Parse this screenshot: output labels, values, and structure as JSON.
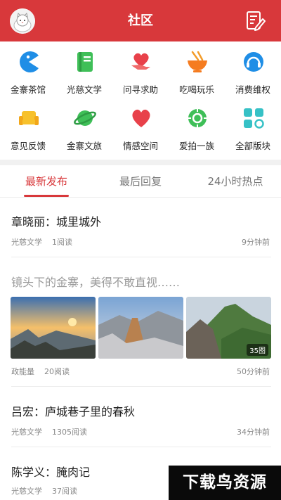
{
  "header": {
    "title": "社区",
    "avatar_icon": "cat-avatar-icon",
    "edit_icon": "edit-note-icon",
    "bg_color": "#d8383b"
  },
  "categories": [
    {
      "label": "金寨茶馆",
      "icon": "pacman-icon"
    },
    {
      "label": "光慈文学",
      "icon": "book-icon"
    },
    {
      "label": "问寻求助",
      "icon": "heart-hand-icon"
    },
    {
      "label": "吃喝玩乐",
      "icon": "noodle-bowl-icon"
    },
    {
      "label": "消费维权",
      "icon": "headset-icon"
    },
    {
      "label": "意见反馈",
      "icon": "sofa-icon"
    },
    {
      "label": "金寨文旅",
      "icon": "planet-icon"
    },
    {
      "label": "情感空间",
      "icon": "heart-icon"
    },
    {
      "label": "爱拍一族",
      "icon": "camera-lens-icon"
    },
    {
      "label": "全部版块",
      "icon": "grid-apps-icon"
    }
  ],
  "tabs": [
    {
      "label": "最新发布",
      "active": true
    },
    {
      "label": "最后回复",
      "active": false
    },
    {
      "label": "24小时热点",
      "active": false
    }
  ],
  "posts": [
    {
      "title": "章晓丽：城里城外",
      "category": "光慈文学",
      "reads": "1阅读",
      "time": "9分钟前"
    },
    {
      "title": "镜头下的金寨，美得不敢直视……",
      "category": "政能量",
      "reads": "20阅读",
      "time": "50分钟前",
      "image_count": "35图"
    },
    {
      "title": "吕宏：庐城巷子里的春秋",
      "category": "光慈文学",
      "reads": "1305阅读",
      "time": "34分钟前"
    },
    {
      "title": "陈学义：腌肉记",
      "category": "光慈文学",
      "reads": "37阅读",
      "time": ""
    }
  ],
  "watermark": "下载鸟资源"
}
